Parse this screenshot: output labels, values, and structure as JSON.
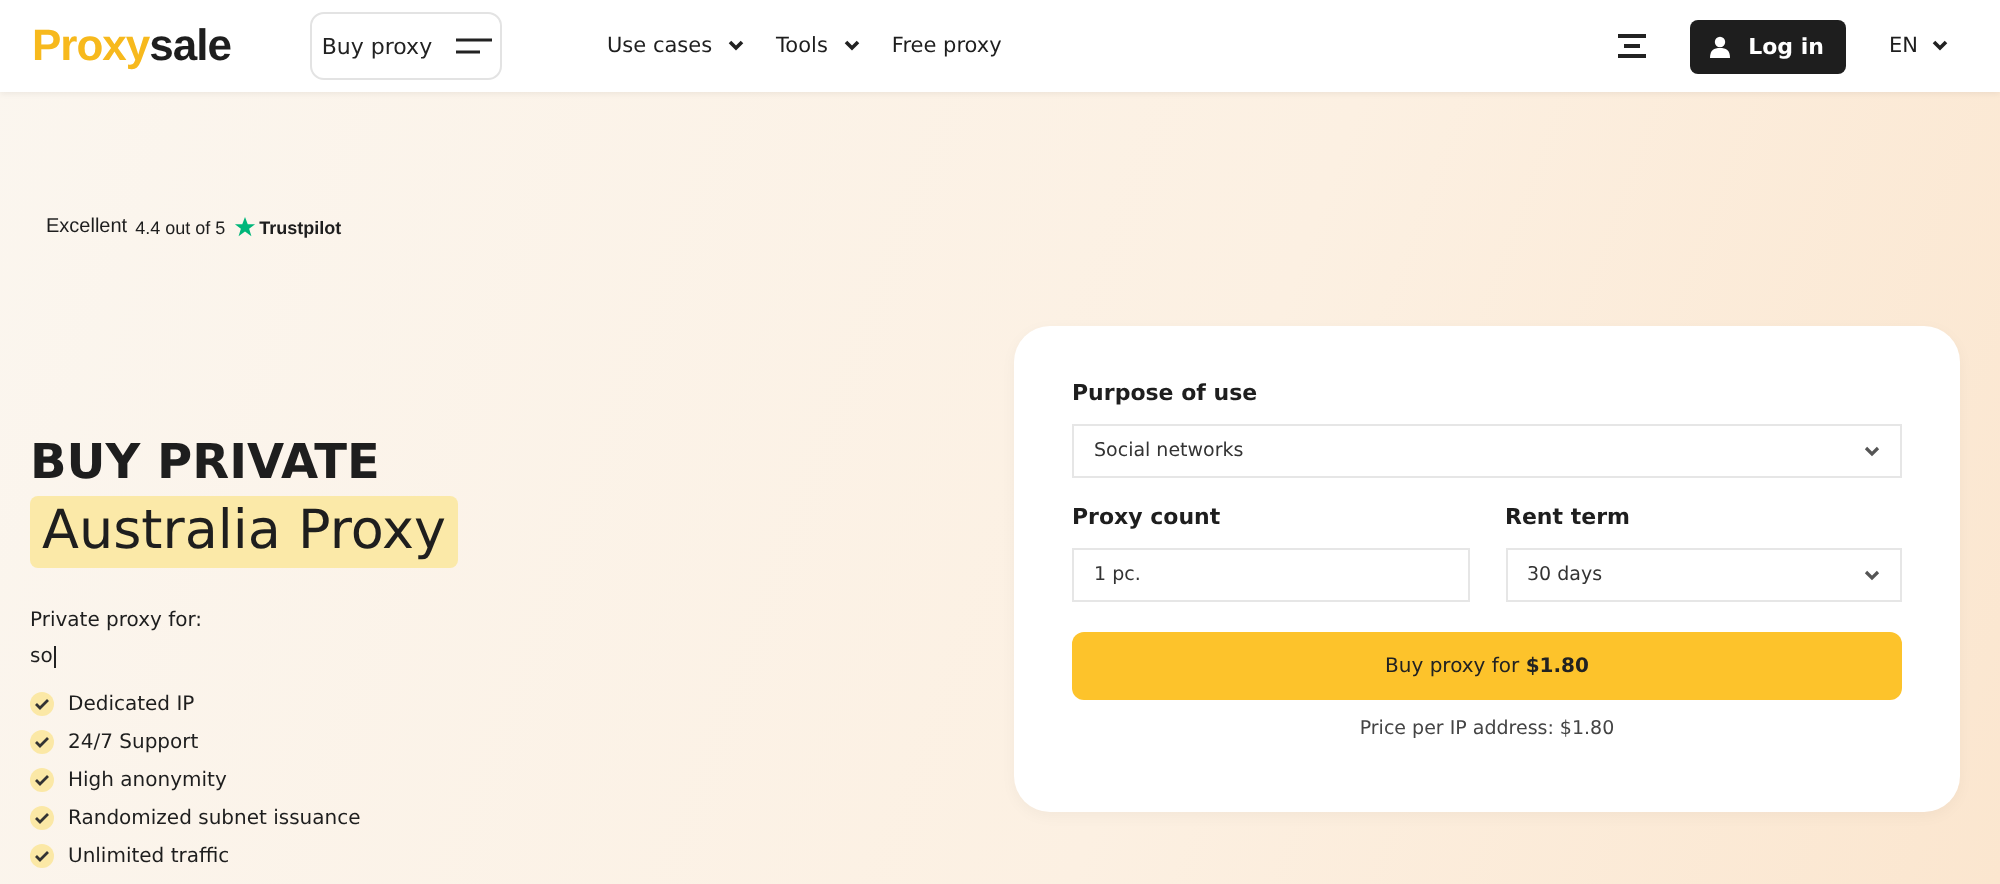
{
  "header": {
    "logo": {
      "prefix": "Proxy",
      "suffix": "sale"
    },
    "buy_button": "Buy proxy",
    "nav": [
      {
        "label": "Use cases",
        "dropdown": true
      },
      {
        "label": "Tools",
        "dropdown": true
      },
      {
        "label": "Free proxy",
        "dropdown": false
      }
    ],
    "login": "Log in",
    "language": "EN"
  },
  "rating": {
    "label": "Excellent",
    "score": "4.4 out of 5",
    "brand": "Trustpilot"
  },
  "hero": {
    "title": "BUY PRIVATE",
    "highlight": "Australia Proxy",
    "subtitle": "Private proxy for:",
    "typed": "so",
    "features": [
      "Dedicated IP",
      "24/7 Support",
      "High anonymity",
      "Randomized subnet issuance",
      "Unlimited traffic"
    ]
  },
  "form": {
    "purpose": {
      "label": "Purpose of use",
      "value": "Social networks"
    },
    "count": {
      "label": "Proxy count",
      "value": "1 pc."
    },
    "term": {
      "label": "Rent term",
      "value": "30 days"
    },
    "submit": "Buy proxy for **$1.80**",
    "price_note": "Price per IP address: $1.80"
  }
}
